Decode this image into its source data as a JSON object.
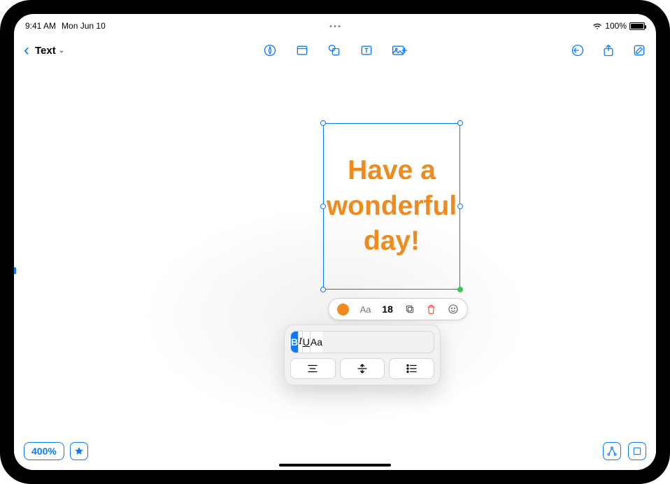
{
  "status": {
    "time": "9:41 AM",
    "date": "Mon Jun 10",
    "battery_pct": "100%"
  },
  "header": {
    "title": "Text"
  },
  "text_box": {
    "content": "Have a wonderful day!",
    "color": "#f08a1d"
  },
  "inline_editor": {
    "font_label": "Aa",
    "font_size": "18"
  },
  "format_panel": {
    "bold": "B",
    "italic": "I",
    "underline": "U",
    "caps": "Aa"
  },
  "zoom": {
    "value": "400%"
  }
}
